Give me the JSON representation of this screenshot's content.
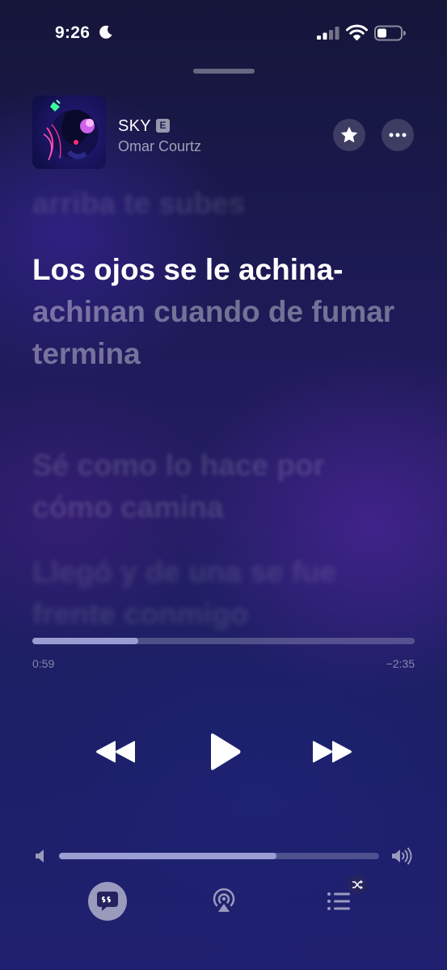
{
  "status_bar": {
    "time": "9:26",
    "focus_icon": "moon-icon",
    "signal_icon": "cellular-signal-icon",
    "wifi_icon": "wifi-icon",
    "battery_icon": "battery-icon"
  },
  "now_playing": {
    "title": "SKY",
    "explicit_badge": "E",
    "artist": "Omar Courtz",
    "favorite_icon": "star-icon",
    "more_icon": "ellipsis-icon"
  },
  "lyrics": {
    "previous": "arriba te subes",
    "current_sung": "Los ojos se le achina-",
    "current_unsung": "achinan cuando de fumar termina",
    "next_1": "Sé como lo hace por cómo camina",
    "next_2": "Llegó y de una se fue frente conmigo"
  },
  "playback": {
    "elapsed": "0:59",
    "remaining": "−2:35",
    "progress_fraction": 0.276
  },
  "controls": {
    "rewind_icon": "backward-icon",
    "play_icon": "play-icon",
    "forward_icon": "forward-icon"
  },
  "volume": {
    "level_fraction": 0.68,
    "low_icon": "speaker-low-icon",
    "high_icon": "speaker-high-icon"
  },
  "bottom_bar": {
    "lyrics_icon": "lyrics-quote-icon",
    "airplay_icon": "airplay-audio-icon",
    "queue_icon": "queue-list-icon",
    "shuffle_icon": "shuffle-icon"
  },
  "colors": {
    "background_top": "#15163a",
    "background_bottom": "#202070",
    "progress_fill": "#c8cdff"
  }
}
